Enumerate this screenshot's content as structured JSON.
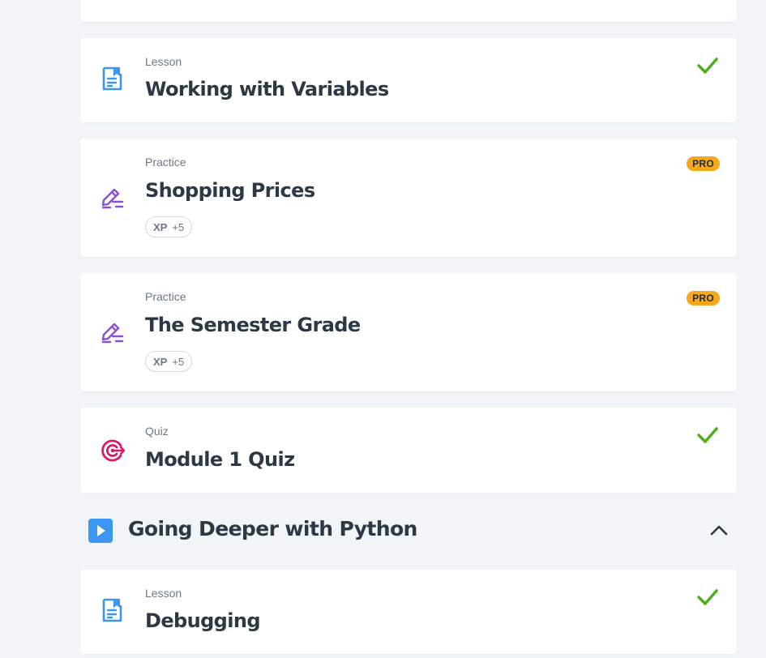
{
  "items": [
    {
      "type": "Lesson",
      "title": "Working with Variables",
      "icon": "lesson-doc-icon",
      "completed": true
    },
    {
      "type": "Practice",
      "title": "Shopping Prices",
      "icon": "practice-pencil-icon",
      "badge": "PRO",
      "xp_label": "XP",
      "xp_value": "+5"
    },
    {
      "type": "Practice",
      "title": "The Semester Grade",
      "icon": "practice-pencil-icon",
      "badge": "PRO",
      "xp_label": "XP",
      "xp_value": "+5"
    },
    {
      "type": "Quiz",
      "title": "Module 1 Quiz",
      "icon": "quiz-target-icon",
      "completed": true
    }
  ],
  "section": {
    "title": "Going Deeper with Python",
    "icon": "play-icon",
    "toggle_icon": "chevron-up-icon",
    "items": [
      {
        "type": "Lesson",
        "title": "Debugging",
        "icon": "lesson-doc-icon",
        "completed": true
      }
    ]
  },
  "colors": {
    "background": "#f2f5f8",
    "lesson_icon": "#3a96f0",
    "practice_icon": "#8a4fd6",
    "quiz_icon": "#d81b6a",
    "check": "#4caf1c",
    "pro_badge": "#f5a81c"
  }
}
